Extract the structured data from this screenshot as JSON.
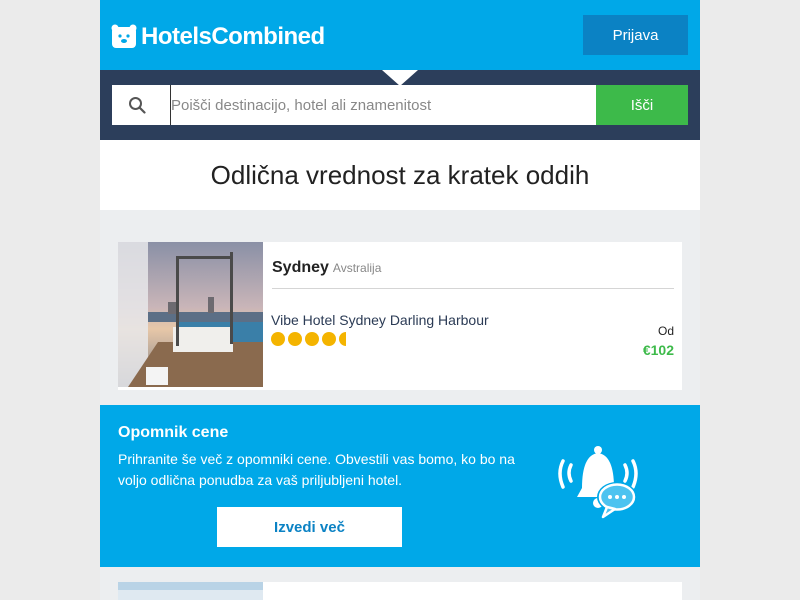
{
  "header": {
    "brand": "HotelsCombined",
    "login_label": "Prijava"
  },
  "search": {
    "placeholder": "Poišči destinacijo, hotel ali znamenitost",
    "button_label": "Išči"
  },
  "section": {
    "title": "Odlična vrednost za kratek oddih"
  },
  "deal": {
    "city": "Sydney",
    "country": "Avstralija",
    "hotel": "Vibe Hotel Sydney Darling Harbour",
    "stars": 4.5,
    "price_label": "Od",
    "price": "€102"
  },
  "price_alert": {
    "title": "Opomnik cene",
    "text": "Prihranite še več z opomniki cene. Obvestili vas bomo, ko bo na voljo odlična ponudba za vaš priljubljeni hotel.",
    "button_label": "Izvedi več"
  },
  "colors": {
    "brand_blue": "#00a8e8",
    "dark_blue": "#0b82c4",
    "navy": "#2c3e5b",
    "green": "#3dba4a",
    "star_yellow": "#f4b400"
  }
}
